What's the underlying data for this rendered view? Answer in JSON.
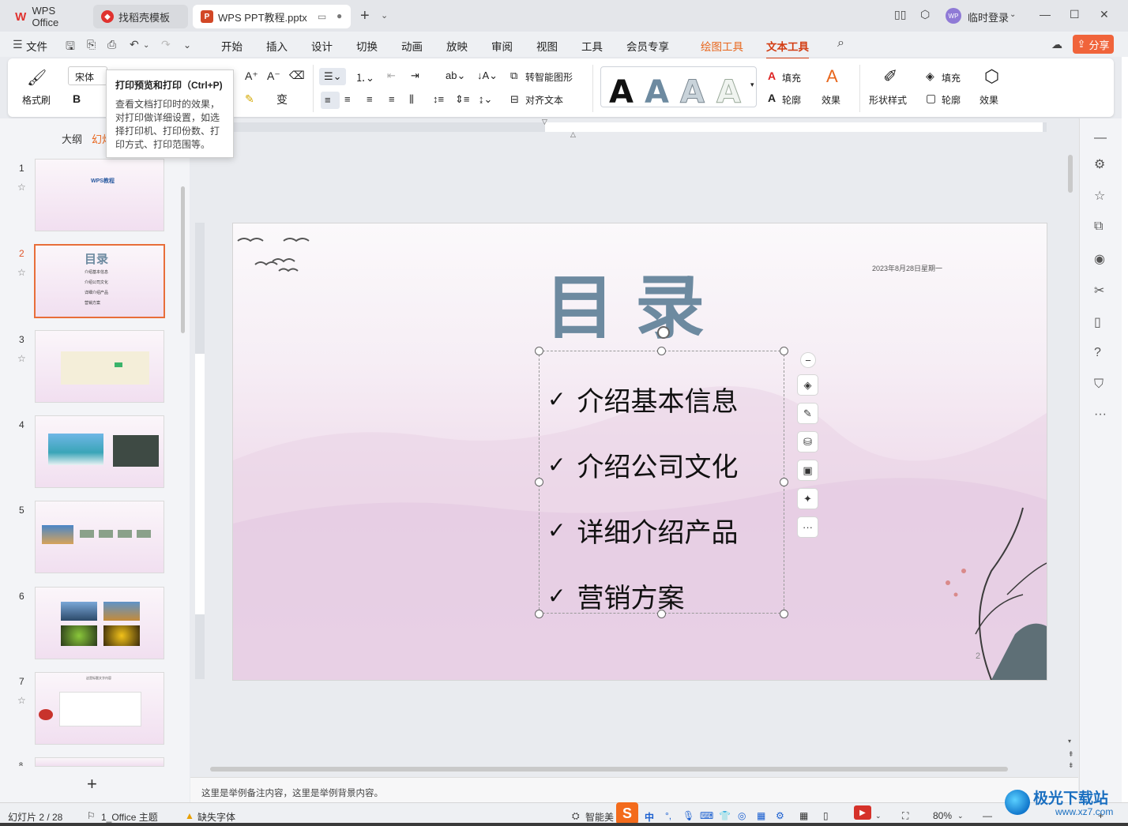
{
  "titlebar": {
    "tab_wps": "WPS Office",
    "tab_daoke": "找稻壳模板",
    "tab_ppt": "WPS PPT教程.pptx",
    "login_avatar": "WP",
    "login_text": "临时登录"
  },
  "menu": {
    "file": "文件",
    "items": [
      "开始",
      "插入",
      "设计",
      "切换",
      "动画",
      "放映",
      "审阅",
      "视图",
      "工具",
      "会员专享"
    ],
    "drawing_tools": "绘图工具",
    "text_tools": "文本工具",
    "share": "分享"
  },
  "ribbon": {
    "format_painter": "格式刷",
    "font_name": "宋体",
    "bold": "B",
    "smart_shape": "转智能图形",
    "align_text": "对齐文本",
    "fill": "填充",
    "outline": "轮廓",
    "effect": "效果",
    "shape_style": "形状样式",
    "shape_fill": "填充",
    "shape_outline": "轮廓",
    "shape_effect": "效果"
  },
  "tooltip": {
    "title": "打印预览和打印（Ctrl+P)",
    "body": "查看文档打印时的效果，对打印做详细设置，如选择打印机、打印份数、打印方式、打印范围等。"
  },
  "left_panel": {
    "tab_outline": "大纲",
    "tab_slides": "幻灯",
    "slide_numbers": [
      "1",
      "2",
      "3",
      "4",
      "5",
      "6",
      "7",
      "8"
    ],
    "thumb1_title": "WPS教程",
    "thumb2_title": "目录",
    "thumb2_items": [
      "介绍基本信息",
      "介绍公司文化",
      "详细介绍产品",
      "营销方案"
    ],
    "thumb7_title": "这是标题文字内容"
  },
  "slide": {
    "title": "目录",
    "date": "2023年8月28日星期一",
    "bullets": [
      "介绍基本信息",
      "介绍公司文化",
      "详细介绍产品",
      "营销方案"
    ],
    "page_number": "2"
  },
  "notes": {
    "text": "这里是举例备注内容，这里是举例背景内容。"
  },
  "statusbar": {
    "slide_counter": "幻灯片 2 / 28",
    "theme": "1_Office 主题",
    "missing_font": "缺失字体",
    "smart_beautify": "智能美",
    "ime_lang": "中",
    "zoom": "80%"
  },
  "watermark": {
    "name": "极光下载站",
    "url": "www.xz7.com"
  },
  "colors": {
    "accent_orange": "#e8661c",
    "text_tools_red": "#d33c12",
    "share_bg": "#f0643b",
    "slide_title": "#6d8aa0"
  }
}
